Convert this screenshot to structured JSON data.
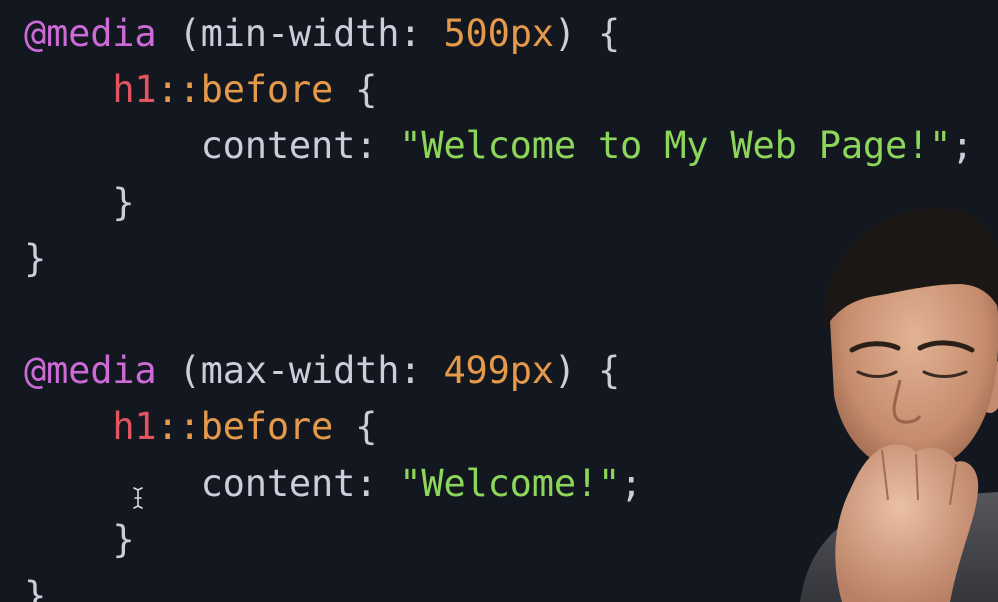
{
  "code_editor": {
    "lines": [
      {
        "indent": "",
        "tokens": [
          {
            "t": "@media",
            "c": "at"
          },
          {
            "t": " (min-width: ",
            "c": "plain"
          },
          {
            "t": "500px",
            "c": "num"
          },
          {
            "t": ") {",
            "c": "plain"
          }
        ]
      },
      {
        "indent": "    ",
        "tokens": [
          {
            "t": "h1",
            "c": "sel"
          },
          {
            "t": "::before",
            "c": "pseudo"
          },
          {
            "t": " {",
            "c": "plain"
          }
        ]
      },
      {
        "indent": "        ",
        "tokens": [
          {
            "t": "content: ",
            "c": "plain"
          },
          {
            "t": "\"Welcome to My Web Page!\"",
            "c": "str"
          },
          {
            "t": ";",
            "c": "plain"
          }
        ]
      },
      {
        "indent": "    ",
        "tokens": [
          {
            "t": "}",
            "c": "plain"
          }
        ]
      },
      {
        "indent": "",
        "tokens": [
          {
            "t": "}",
            "c": "plain"
          }
        ]
      },
      {
        "indent": "",
        "tokens": []
      },
      {
        "indent": "",
        "tokens": [
          {
            "t": "@media",
            "c": "at"
          },
          {
            "t": " (max-width: ",
            "c": "plain"
          },
          {
            "t": "499px",
            "c": "num"
          },
          {
            "t": ") {",
            "c": "plain"
          }
        ]
      },
      {
        "indent": "    ",
        "tokens": [
          {
            "t": "h1",
            "c": "sel"
          },
          {
            "t": "::before",
            "c": "pseudo"
          },
          {
            "t": " {",
            "c": "plain"
          }
        ]
      },
      {
        "indent": "        ",
        "tokens": [
          {
            "t": "content: ",
            "c": "plain"
          },
          {
            "t": "\"Welcome!\"",
            "c": "str"
          },
          {
            "t": ";",
            "c": "plain"
          }
        ]
      },
      {
        "indent": "    ",
        "tokens": [
          {
            "t": "}",
            "c": "plain"
          }
        ]
      },
      {
        "indent": "",
        "tokens": [
          {
            "t": "}",
            "c": "plain"
          }
        ]
      }
    ]
  },
  "colors": {
    "background": "#121720",
    "at_rule": "#cc6ad6",
    "selector": "#e2555f",
    "pseudo": "#e49a48",
    "number": "#e49a48",
    "string": "#8ed65a",
    "plain": "#c9ced8"
  },
  "icons": {
    "text_cursor": "i-beam-cursor-icon"
  }
}
